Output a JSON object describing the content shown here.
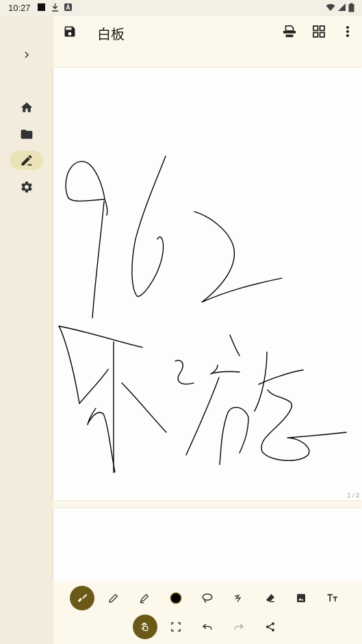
{
  "status": {
    "time": "10:27",
    "left_icons": [
      "notification-square-icon",
      "download-icon",
      "font-icon"
    ],
    "right_icons": [
      "wifi-icon",
      "signal-icon",
      "battery-icon"
    ]
  },
  "rail": {
    "expand_icon": "chevron-right-icon",
    "items": [
      {
        "name": "home",
        "icon": "home-icon",
        "active": false
      },
      {
        "name": "browser",
        "icon": "folder-icon",
        "active": false
      },
      {
        "name": "editor",
        "icon": "edit-icon",
        "active": true
      },
      {
        "name": "settings",
        "icon": "gear-icon",
        "active": false
      }
    ]
  },
  "appbar": {
    "title": "白板",
    "save_icon": "save-icon",
    "actions": [
      "print-icon",
      "grid-view-icon",
      "more-vert-icon"
    ]
  },
  "pages": {
    "indicator": "1 / 2"
  },
  "toolbar": {
    "row1": [
      "brush-icon",
      "pencil-icon",
      "highlighter-icon",
      "color-swatch",
      "lasso-icon",
      "laser-icon",
      "eraser-icon",
      "image-icon",
      "text-icon"
    ],
    "row2": [
      "touch-draw-icon",
      "fullscreen-icon",
      "undo-icon",
      "redo-icon",
      "share-icon"
    ],
    "active_tool": "brush-icon",
    "accent": "#6b5a17",
    "current_color": "#000000"
  }
}
